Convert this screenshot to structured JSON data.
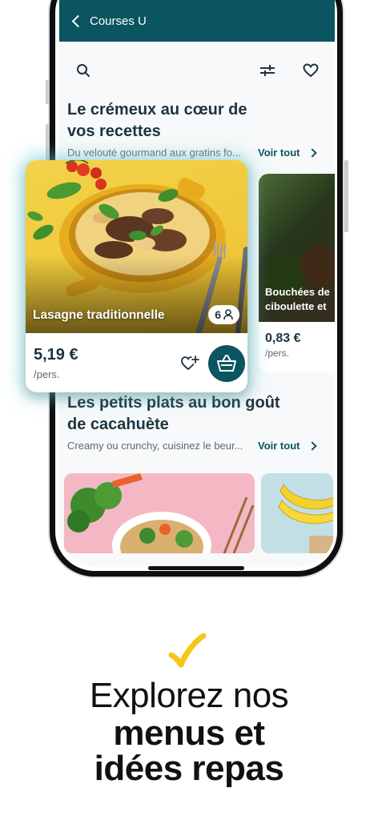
{
  "topbar": {
    "title": "Courses U"
  },
  "toolbar": {
    "icons": [
      "search-icon",
      "filter-icon",
      "heart-icon"
    ]
  },
  "section1": {
    "title": "Le crémeux au cœur de vos recettes",
    "description": "Du velouté gourmand aux gratins fo...",
    "see_all": "Voir tout"
  },
  "featured_card": {
    "name": "Lasagne traditionnelle",
    "servings": "6",
    "price": "5,19 €",
    "unit": "/pers."
  },
  "second_card": {
    "name": "Bouchées de\nciboulette et",
    "price": "0,83 €",
    "unit": "/pers."
  },
  "section2": {
    "title": "Les petits plats au bon goût de cacahuète",
    "description": "Creamy ou crunchy, cuisinez le beur...",
    "see_all": "Voir tout"
  },
  "promo": {
    "line1": "Explorez nos",
    "line2": "menus et",
    "line3": "idées repas"
  },
  "colors": {
    "primary": "#0a5560",
    "accent_check": "#f5c518",
    "highlight_glow": "#6ec8d2"
  }
}
